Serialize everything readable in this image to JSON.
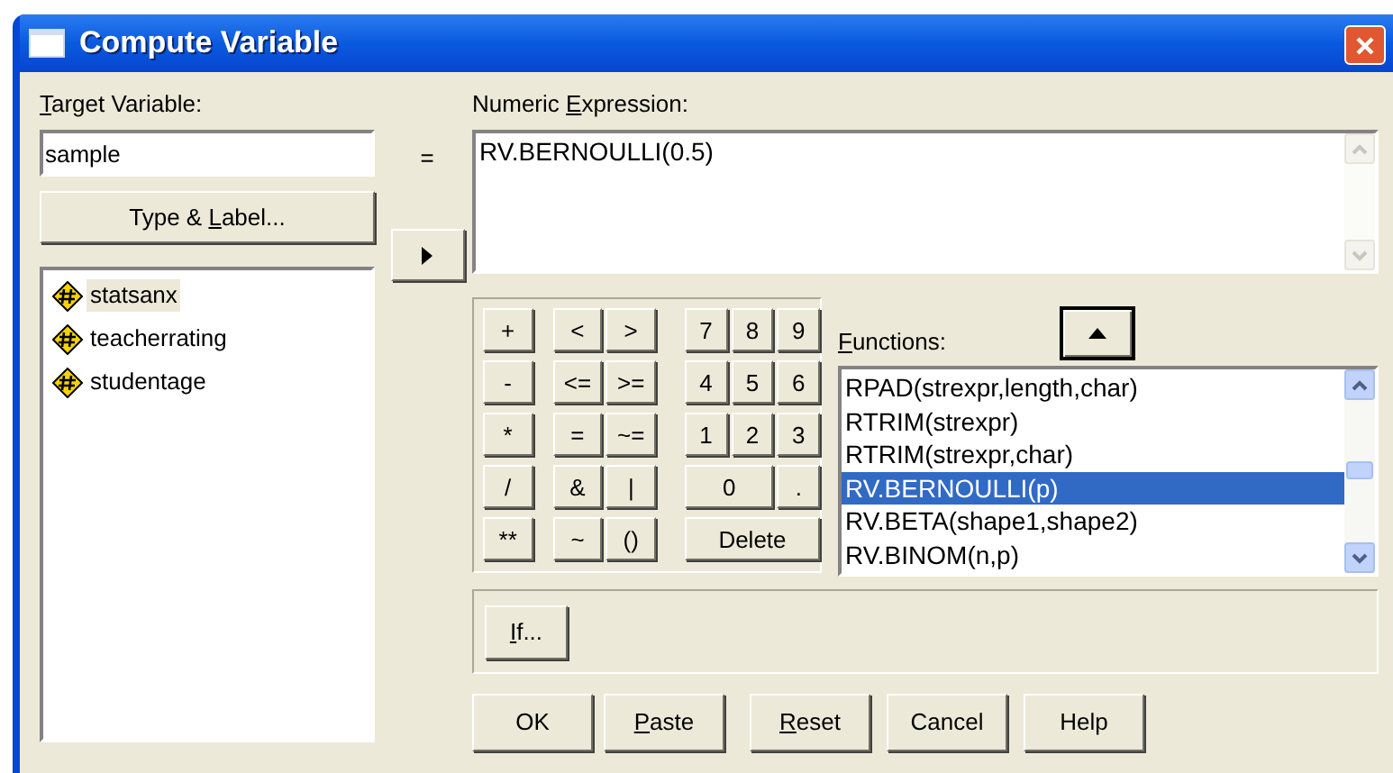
{
  "window": {
    "title": "Compute Variable"
  },
  "target": {
    "label": {
      "key": "T",
      "after": "arget Variable:"
    },
    "value": "sample"
  },
  "equals": "=",
  "type_label_button": {
    "label": {
      "before": "Type & ",
      "key": "L",
      "after": "abel..."
    }
  },
  "variables": [
    {
      "name": "statsanx",
      "selected": true
    },
    {
      "name": "teacherrating",
      "selected": false
    },
    {
      "name": "studentage",
      "selected": false
    }
  ],
  "expression": {
    "label": {
      "before": "Numeric ",
      "key": "E",
      "after": "xpression:"
    },
    "value": "RV.BERNOULLI(0.5)"
  },
  "keypad": [
    [
      {
        "label": "+",
        "kind": "op"
      },
      {
        "label": "<",
        "kind": "op"
      },
      {
        "label": ">",
        "kind": "op"
      },
      {
        "label": "7",
        "kind": "digit"
      },
      {
        "label": "8",
        "kind": "digit"
      },
      {
        "label": "9",
        "kind": "digit"
      }
    ],
    [
      {
        "label": "-",
        "kind": "op"
      },
      {
        "label": "<=",
        "kind": "op"
      },
      {
        "label": ">=",
        "kind": "op"
      },
      {
        "label": "4",
        "kind": "digit"
      },
      {
        "label": "5",
        "kind": "digit"
      },
      {
        "label": "6",
        "kind": "digit"
      }
    ],
    [
      {
        "label": "*",
        "kind": "op"
      },
      {
        "label": "=",
        "kind": "op"
      },
      {
        "label": "~=",
        "kind": "op"
      },
      {
        "label": "1",
        "kind": "digit"
      },
      {
        "label": "2",
        "kind": "digit"
      },
      {
        "label": "3",
        "kind": "digit"
      }
    ],
    [
      {
        "label": "/",
        "kind": "op"
      },
      {
        "label": "&",
        "kind": "op"
      },
      {
        "label": "|",
        "kind": "op"
      },
      {
        "label": "0",
        "kind": "wide"
      },
      {
        "label": ".",
        "kind": "digit"
      }
    ],
    [
      {
        "label": "**",
        "kind": "op"
      },
      {
        "label": "~",
        "kind": "op"
      },
      {
        "label": "()",
        "kind": "op"
      },
      {
        "label": "Delete",
        "kind": "delete"
      }
    ]
  ],
  "functions": {
    "label": {
      "key": "F",
      "after": "unctions:"
    },
    "items": [
      {
        "text": "RPAD(strexpr,length,char)",
        "selected": false
      },
      {
        "text": "RTRIM(strexpr)",
        "selected": false
      },
      {
        "text": "RTRIM(strexpr,char)",
        "selected": false
      },
      {
        "text": "RV.BERNOULLI(p)",
        "selected": true
      },
      {
        "text": "RV.BETA(shape1,shape2)",
        "selected": false
      },
      {
        "text": "RV.BINOM(n,p)",
        "selected": false
      }
    ]
  },
  "if_button": {
    "label": {
      "key": "I",
      "after": "f..."
    }
  },
  "buttons": [
    {
      "label": {
        "before": "OK"
      }
    },
    {
      "label": {
        "key": "P",
        "after": "aste"
      }
    },
    {
      "label": {
        "key": "R",
        "after": "eset"
      }
    },
    {
      "label": {
        "before": "Cancel"
      }
    },
    {
      "label": {
        "before": "Help"
      }
    }
  ]
}
